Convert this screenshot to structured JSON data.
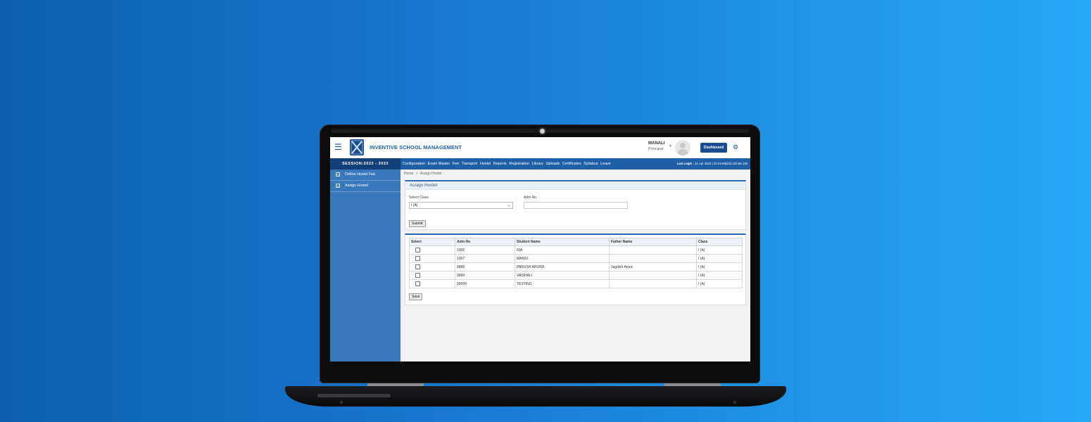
{
  "header": {
    "app_title": "INVENTIVE SCHOOL MANAGEMENT",
    "user_name": "MANALI",
    "user_role": "Principal",
    "dashboard_label": "Dashboard"
  },
  "navbar": {
    "session": "SESSION:2022 - 2023",
    "menu": [
      "Configuration",
      "Exam Master",
      "Fee",
      "Transport",
      "Hostel",
      "Reports",
      "Registration",
      "Library",
      "Uploads",
      "Certificates",
      "Syllabus",
      "Leave"
    ],
    "last_login_label": "Last Login :",
    "last_login_value": "21 Apr 2023 | 10:41AM|223.233.66.126"
  },
  "sidebar": {
    "items": [
      {
        "label": "Define Hostel Fee"
      },
      {
        "label": "Assign Hostel"
      }
    ]
  },
  "breadcrumb": {
    "home": "Home",
    "separator": ">",
    "current": "Assign Hostel"
  },
  "form": {
    "title": "Assign Hostel",
    "class_label": "Select Class",
    "class_value": "I (A)",
    "adm_label": "Adm No.",
    "adm_value": "",
    "submit_label": "Submit"
  },
  "table": {
    "headers": [
      "Select",
      "Adm No",
      "Student Name",
      "Father Name",
      "Class"
    ],
    "rows": [
      {
        "adm_no": "1006",
        "student": "NIA",
        "father": "",
        "class": "I (A)"
      },
      {
        "adm_no": "1007",
        "student": "MANSI",
        "father": "",
        "class": "I (A)"
      },
      {
        "adm_no": "8888",
        "student": "PARUSH ARORA",
        "father": "Jagdish Arora",
        "class": "I (A)"
      },
      {
        "adm_no": "9999",
        "student": "VAISHALI",
        "father": "",
        "class": "I (A)"
      },
      {
        "adm_no": "99999",
        "student": "TESTING",
        "father": "",
        "class": "I (A)"
      }
    ],
    "save_label": "Save"
  },
  "colors": {
    "background_start": "#0d5fae",
    "background_end": "#27a8f5",
    "navbar": "#1f5fa8",
    "session_bar": "#133f78",
    "sidebar": "#3a78bd",
    "accent": "#1a4d8f"
  },
  "icons": {
    "menu": "hamburger-icon",
    "settings": "gear-icon",
    "sidebar_item": "table-icon"
  }
}
